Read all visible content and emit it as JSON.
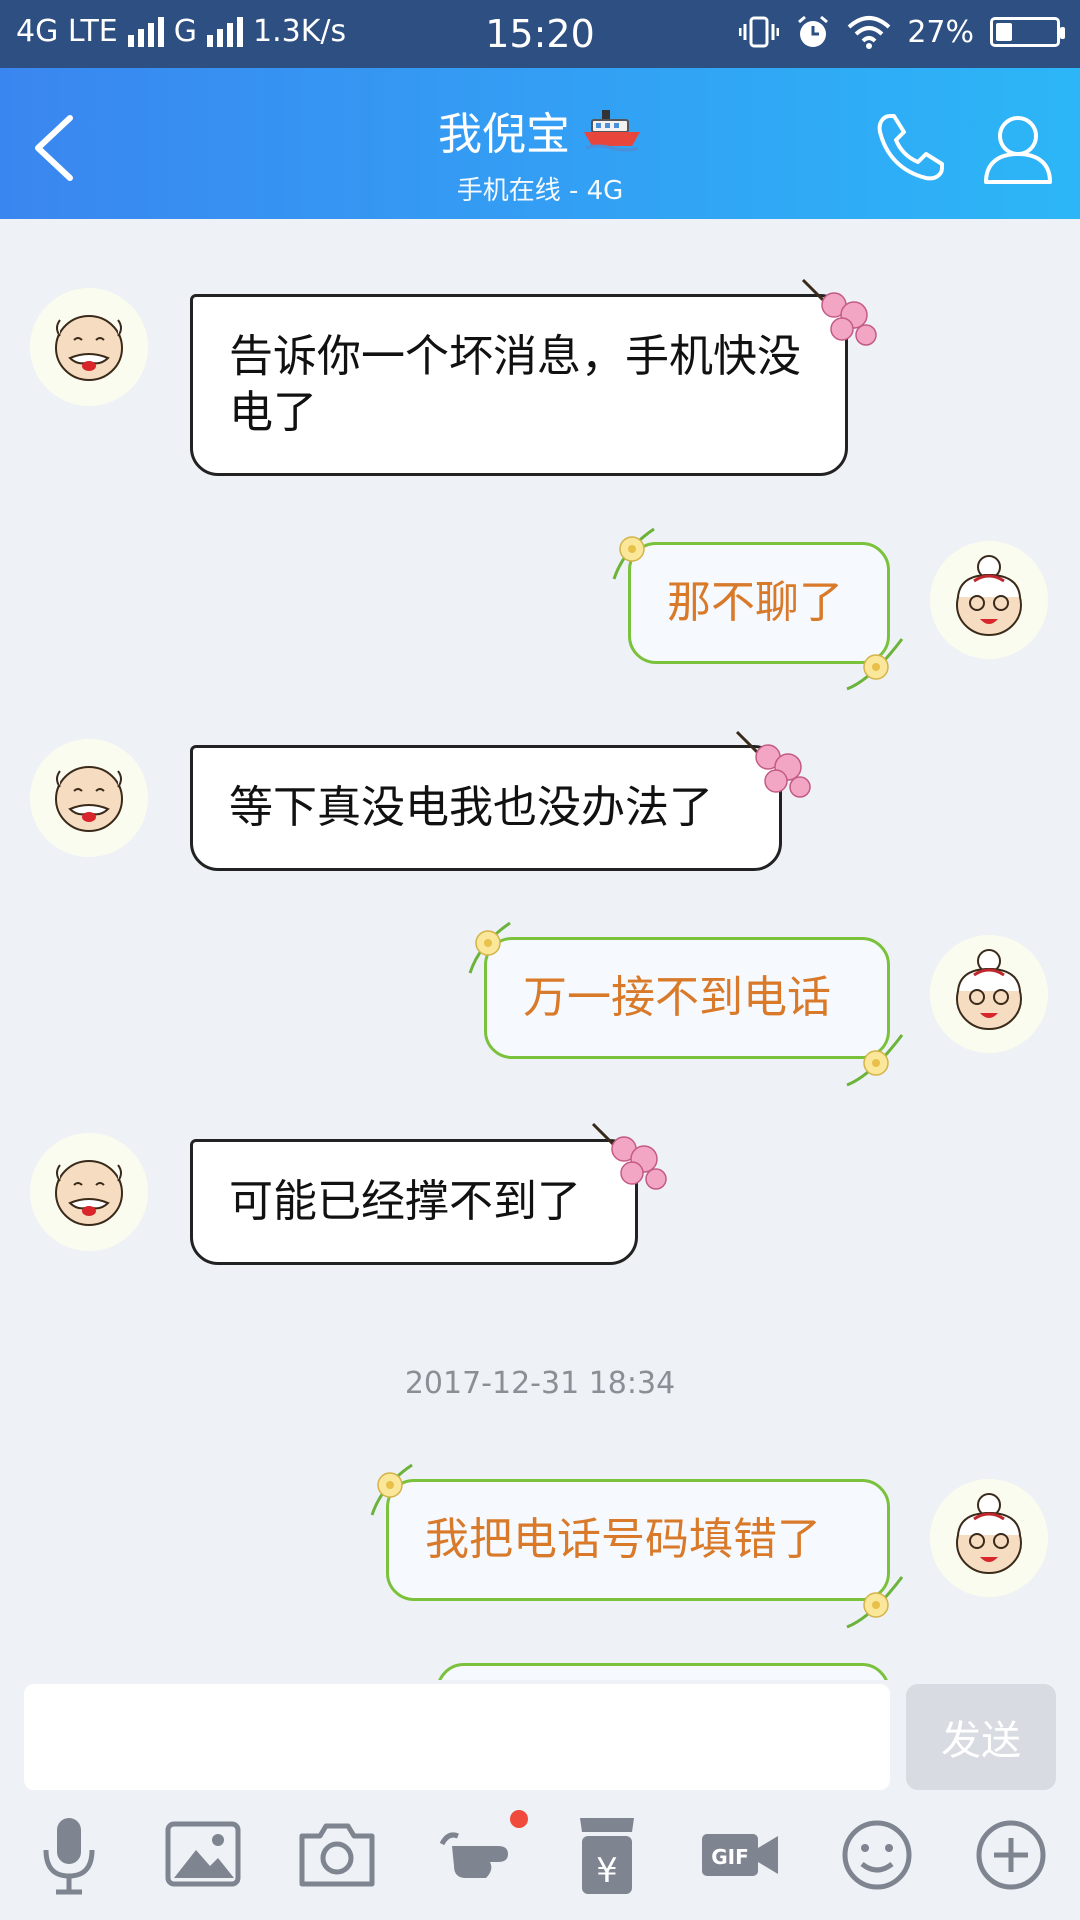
{
  "status_bar": {
    "network_left": "4G LTE",
    "network_right": "G",
    "speed": "1.3K/s",
    "time": "15:20",
    "battery_text": "27%",
    "battery_level": 0.27
  },
  "header": {
    "title": "我倪宝",
    "subtitle": "手机在线 - 4G"
  },
  "messages": [
    {
      "direction": "incoming",
      "text": "告诉你一个坏消息，手机快没电了"
    },
    {
      "direction": "outgoing",
      "text": "那不聊了"
    },
    {
      "direction": "incoming",
      "text": "等下真没电我也没办法了"
    },
    {
      "direction": "outgoing",
      "text": "万一接不到电话"
    },
    {
      "direction": "incoming",
      "text": "可能已经撑不到了"
    },
    {
      "direction": "outgoing",
      "text": "我把电话号码填错了"
    }
  ],
  "timestamp": "2017-12-31 18:34",
  "composer": {
    "placeholder": "",
    "send_label": "发送"
  },
  "toolbar_icons": [
    "microphone-icon",
    "image-icon",
    "camera-icon",
    "poke-icon",
    "red-packet-icon",
    "gif-icon",
    "emoji-icon",
    "plus-icon"
  ],
  "colors": {
    "header_start": "#3a86f0",
    "header_end": "#2cb6f7",
    "outgoing_text": "#d97a2b",
    "outgoing_border": "#7ac23b",
    "badge": "#f04a3c"
  }
}
